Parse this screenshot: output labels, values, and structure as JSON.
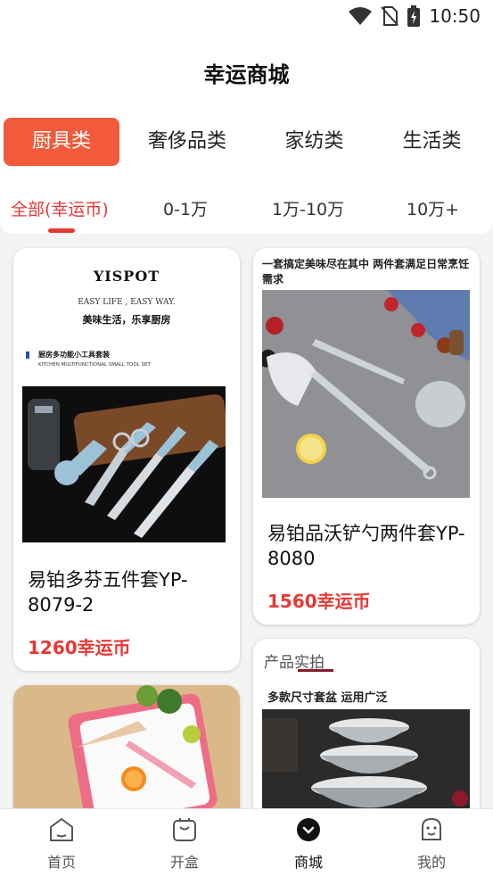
{
  "status": {
    "time": "10:50"
  },
  "header": {
    "title": "幸运商城"
  },
  "categories": [
    {
      "label": "厨具类"
    },
    {
      "label": "奢侈品类"
    },
    {
      "label": "家纺类"
    },
    {
      "label": "生活类"
    }
  ],
  "price_filters": [
    {
      "label": "全部(幸运币)"
    },
    {
      "label": "0-1万"
    },
    {
      "label": "1万-10万"
    },
    {
      "label": "10万+"
    }
  ],
  "products": [
    {
      "name": "易铂多芬五件套YP-8079-2",
      "price": "1260幸运币",
      "image": {
        "brand": "YISPOT",
        "slogan_en": "EASY LIFE , EASY WAY.",
        "slogan_cn": "美味生活，乐享厨房",
        "set_cn": "厨房多功能小工具套装",
        "set_en": "KITCHEN MULTIFUNCTIONAL SMALL TOOL SET"
      }
    },
    {
      "name": "易铂品沃铲勺两件套YP-8080",
      "price": "1560幸运币",
      "image": {
        "caption": "一套搞定美味尽在其中 两件套满足日常烹饪需求"
      }
    },
    {
      "name": "",
      "price": "",
      "image": {
        "text": ""
      }
    },
    {
      "name": "",
      "price": "",
      "image": {
        "tag": "产品实拍",
        "caption": "多款尺寸套盆  运用广泛"
      }
    }
  ],
  "tabbar": [
    {
      "label": "首页",
      "icon": "home-icon"
    },
    {
      "label": "开盒",
      "icon": "box-icon"
    },
    {
      "label": "商城",
      "icon": "mall-icon"
    },
    {
      "label": "我的",
      "icon": "profile-icon"
    }
  ],
  "colors": {
    "accent": "#f15a3a",
    "price": "#e53935"
  }
}
